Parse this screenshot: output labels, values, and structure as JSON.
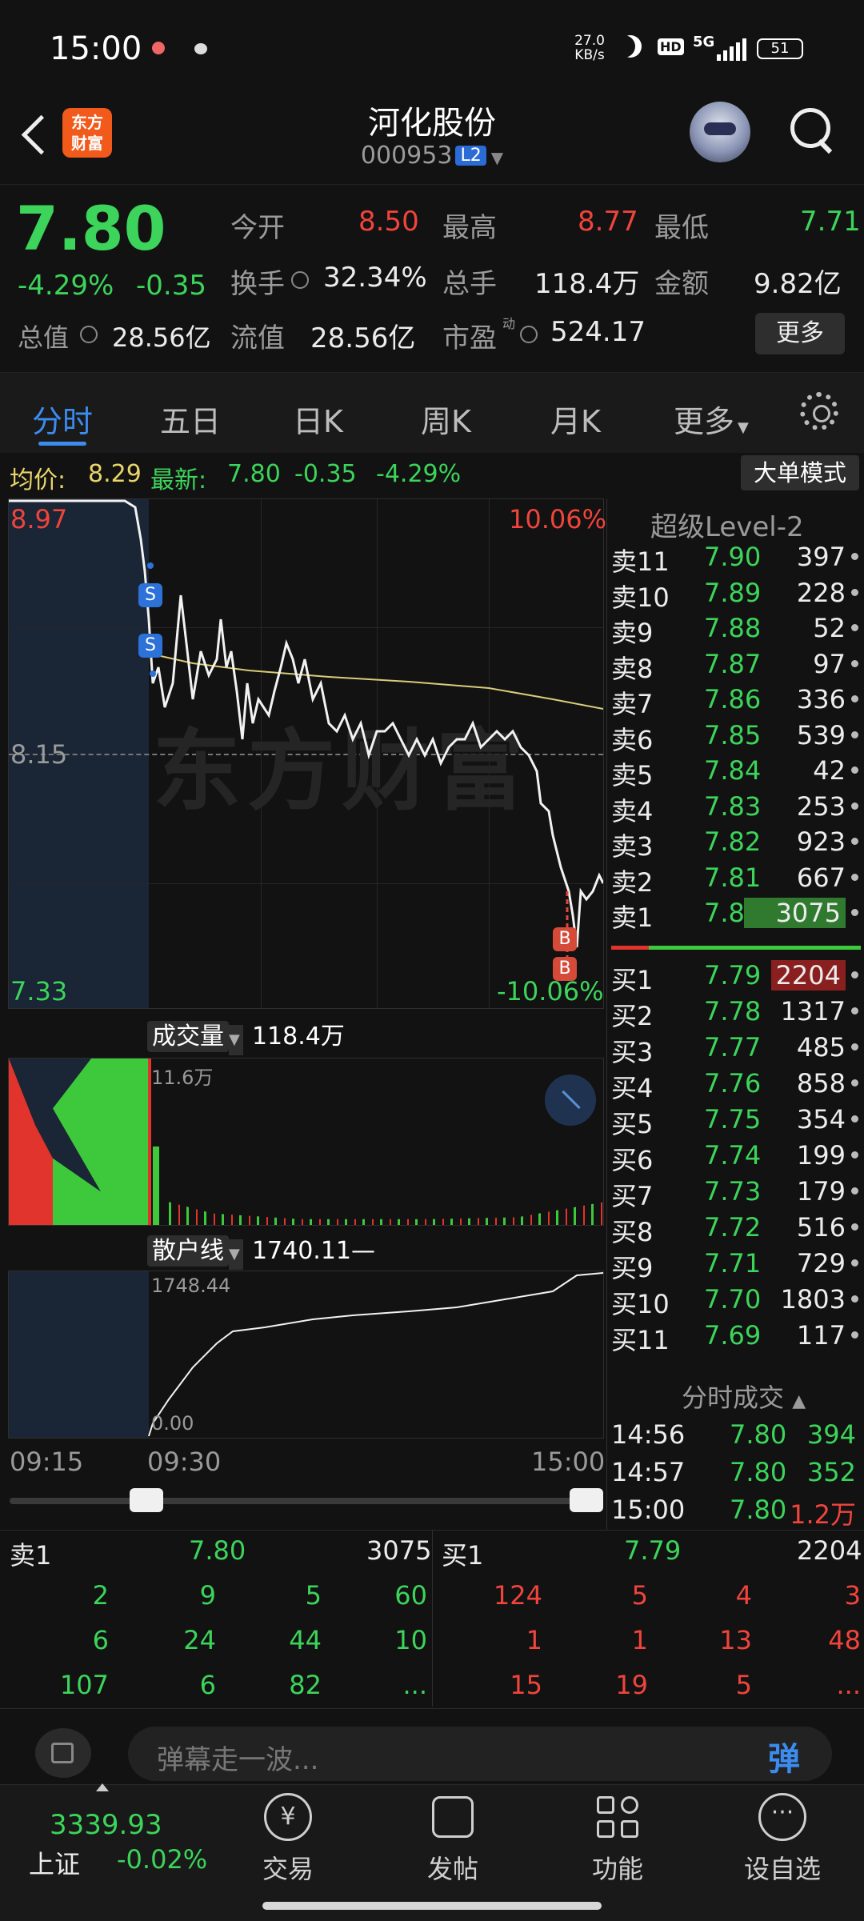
{
  "status_bar": {
    "time": "15:00",
    "speed": "27.0 KB/s",
    "hd": "HD",
    "net": "5G",
    "battery": "51"
  },
  "header": {
    "logo_line1": "东方",
    "logo_line2": "财富",
    "title": "河化股份",
    "code": "000953",
    "badge": "L2"
  },
  "quote": {
    "price": "7.80",
    "pct": "-4.29%",
    "chg": "-0.35",
    "open_label": "今开",
    "open": "8.50",
    "high_label": "最高",
    "high": "8.77",
    "low_label": "最低",
    "low": "7.71",
    "turnover_label": "换手",
    "turnover": "32.34%",
    "volume_label": "总手",
    "volume": "118.4万",
    "amount_label": "金额",
    "amount": "9.82亿",
    "mktcap_label": "总值",
    "mktcap": "28.56亿",
    "float_label": "流值",
    "float": "28.56亿",
    "pe_label": "市盈",
    "pe_sup": "动",
    "pe": "524.17",
    "more": "更多"
  },
  "tabs": [
    "分时",
    "五日",
    "日K",
    "周K",
    "月K",
    "更多"
  ],
  "chart_header": {
    "avg_label": "均价:",
    "avg": "8.29",
    "latest_label": "最新:",
    "latest": "7.80",
    "chg": "-0.35",
    "pct": "-4.29%",
    "mode_button": "大单模式"
  },
  "chart": {
    "top_price": "8.97",
    "top_pct": "10.06%",
    "mid_price": "8.15",
    "bot_price": "7.33",
    "bot_pct": "-10.06%",
    "s_marker": "S",
    "b_marker": "B",
    "watermark": "东方财富"
  },
  "volume": {
    "label": "成交量",
    "value": "118.4万",
    "scale": "11.6万"
  },
  "retail": {
    "label": "散户线",
    "value": "1740.11—",
    "top": "1748.44",
    "bottom": "0.00"
  },
  "time_axis": {
    "start": "09:15",
    "open": "09:30",
    "end": "15:00"
  },
  "level2_title": "超级Level-2",
  "asks": [
    {
      "label": "卖11",
      "price": "7.90",
      "vol": "397"
    },
    {
      "label": "卖10",
      "price": "7.89",
      "vol": "228"
    },
    {
      "label": "卖9",
      "price": "7.88",
      "vol": "52"
    },
    {
      "label": "卖8",
      "price": "7.87",
      "vol": "97"
    },
    {
      "label": "卖7",
      "price": "7.86",
      "vol": "336"
    },
    {
      "label": "卖6",
      "price": "7.85",
      "vol": "539"
    },
    {
      "label": "卖5",
      "price": "7.84",
      "vol": "42"
    },
    {
      "label": "卖4",
      "price": "7.83",
      "vol": "253"
    },
    {
      "label": "卖3",
      "price": "7.82",
      "vol": "923"
    },
    {
      "label": "卖2",
      "price": "7.81",
      "vol": "667"
    },
    {
      "label": "卖1",
      "price": "7.80",
      "vol": "3075"
    }
  ],
  "bids": [
    {
      "label": "买1",
      "price": "7.79",
      "vol": "2204"
    },
    {
      "label": "买2",
      "price": "7.78",
      "vol": "1317"
    },
    {
      "label": "买3",
      "price": "7.77",
      "vol": "485"
    },
    {
      "label": "买4",
      "price": "7.76",
      "vol": "858"
    },
    {
      "label": "买5",
      "price": "7.75",
      "vol": "354"
    },
    {
      "label": "买6",
      "price": "7.74",
      "vol": "199"
    },
    {
      "label": "买7",
      "price": "7.73",
      "vol": "179"
    },
    {
      "label": "买8",
      "price": "7.72",
      "vol": "516"
    },
    {
      "label": "买9",
      "price": "7.71",
      "vol": "729"
    },
    {
      "label": "买10",
      "price": "7.70",
      "vol": "1803"
    },
    {
      "label": "买11",
      "price": "7.69",
      "vol": "117"
    }
  ],
  "trades_title": "分时成交",
  "trades": [
    {
      "time": "14:56",
      "price": "7.80",
      "vol": "394"
    },
    {
      "time": "14:57",
      "price": "7.80",
      "vol": "352"
    },
    {
      "time": "15:00",
      "price": "7.80",
      "vol": "1.2万"
    }
  ],
  "queue": {
    "sell_label": "卖1",
    "sell_price": "7.80",
    "sell_total": "3075",
    "buy_label": "买1",
    "buy_price": "7.79",
    "buy_total": "2204",
    "sell_rows": [
      [
        "2",
        "9",
        "5",
        "60"
      ],
      [
        "6",
        "24",
        "44",
        "10"
      ],
      [
        "107",
        "6",
        "82",
        "..."
      ]
    ],
    "buy_rows": [
      [
        "124",
        "5",
        "4",
        "3"
      ],
      [
        "1",
        "1",
        "13",
        "48"
      ],
      [
        "15",
        "19",
        "5",
        "..."
      ]
    ]
  },
  "danmaku": {
    "placeholder": "弹幕走一波...",
    "button": "弹"
  },
  "nav": {
    "index_value": "3339.93",
    "index_name": "上证",
    "index_pct": "-0.02%",
    "items": [
      "交易",
      "发帖",
      "功能",
      "设自选"
    ]
  }
}
